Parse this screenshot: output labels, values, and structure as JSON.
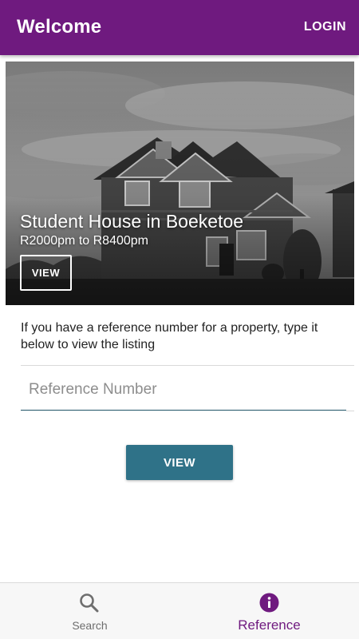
{
  "app_bar": {
    "title": "Welcome",
    "action_label": "LOGIN",
    "color": "#6f1a7f"
  },
  "featured": {
    "title": "Student House in Boeketoe",
    "price_range": "R2000pm to R8400pm",
    "button_label": "VIEW",
    "image": "house-photo"
  },
  "reference": {
    "instructions": "If you have a reference number for a property, type it below to view the listing",
    "input_placeholder": "Reference Number",
    "input_value": "",
    "button_label": "VIEW",
    "button_color": "#2f7288"
  },
  "bottom_nav": {
    "items": [
      {
        "label": "Search",
        "icon": "search-icon",
        "active": false
      },
      {
        "label": "Reference",
        "icon": "info-icon",
        "active": true
      }
    ],
    "active_color": "#6f1a7f"
  }
}
